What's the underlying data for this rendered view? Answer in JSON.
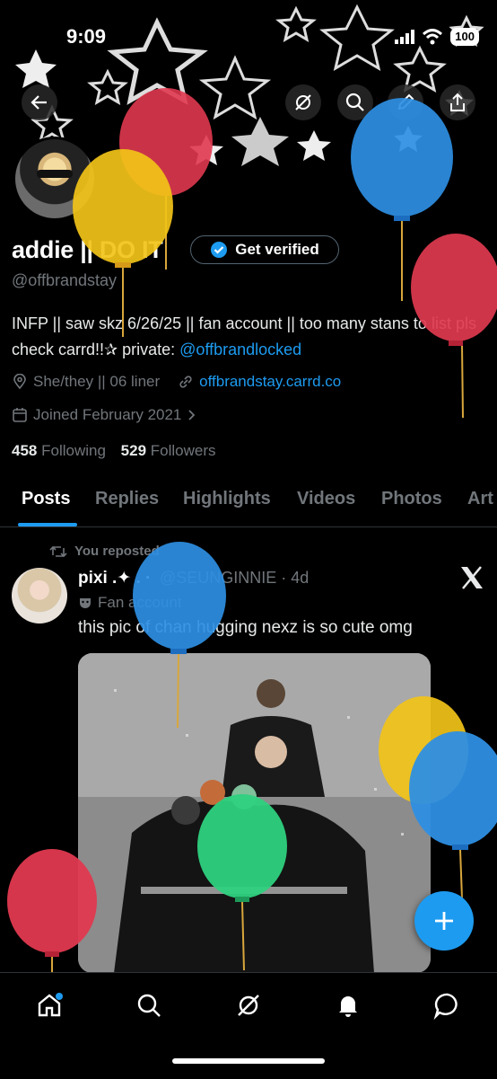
{
  "status_bar": {
    "time": "9:09",
    "battery": "100"
  },
  "profile": {
    "display_name": "addie || DO IT",
    "verify_label": "Get verified",
    "handle": "@offbrandstay",
    "bio_text": "INFP || saw skz 6/26/25 || fan account || too many stans to list pls check carrd!!✰ private: ",
    "bio_link": "@offbrandlocked",
    "location": "She/they || 06 liner",
    "website": "offbrandstay.carrd.co",
    "joined": "Joined February 2021",
    "following_count": "458",
    "following_label": "Following",
    "followers_count": "529",
    "followers_label": "Followers"
  },
  "tabs": [
    {
      "label": "Posts"
    },
    {
      "label": "Replies"
    },
    {
      "label": "Highlights"
    },
    {
      "label": "Videos"
    },
    {
      "label": "Photos"
    },
    {
      "label": "Art"
    }
  ],
  "post": {
    "repost_label": "You reposted",
    "author_name": "pixi .✦ . ·",
    "author_handle_time": "@SEUNGINNIE · 4d",
    "fan_label": "Fan account",
    "text": "this pic of chan hugging nexz is so cute omg"
  },
  "icons": {
    "back": "arrow-left-icon",
    "grok": "grok-icon",
    "search": "search-icon",
    "edit": "pencil-icon",
    "share": "share-icon"
  },
  "colors": {
    "accent": "#1d9bf0",
    "background": "#000000"
  }
}
